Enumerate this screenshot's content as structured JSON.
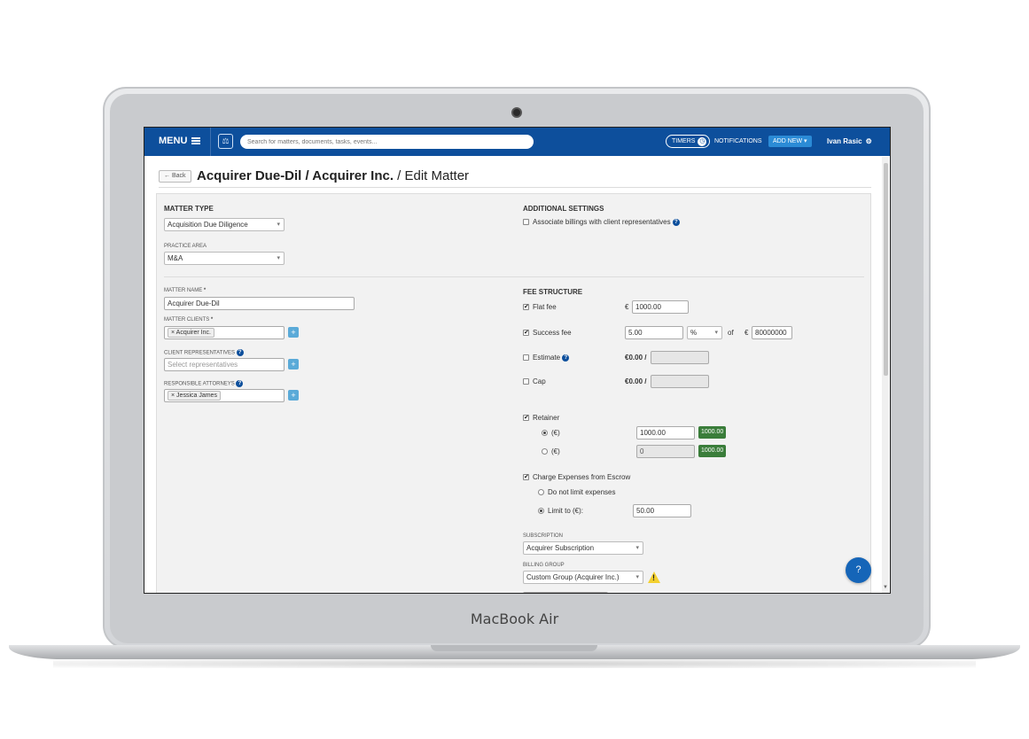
{
  "device": {
    "brand": "MacBook Air"
  },
  "topbar": {
    "menu_label": "MENU",
    "search_placeholder": "Search for matters, documents, tasks, events...",
    "timers_label": "TIMERS",
    "notifications_label": "NOTIFICATIONS",
    "add_new_label": "ADD NEW",
    "user_name": "Ivan Rasic"
  },
  "page": {
    "back_label": "← Back",
    "title_bold": "Acquirer Due-Dil / Acquirer Inc.",
    "title_rest": " / Edit Matter"
  },
  "left": {
    "matter_type_heading": "MATTER TYPE",
    "matter_type_value": "Acquisition Due Diligence",
    "practice_area_label": "PRACTICE AREA",
    "practice_area_value": "M&A",
    "matter_name_label": "MATTER NAME",
    "required_mark": "*",
    "matter_name_value": "Acquirer Due-Dil",
    "matter_clients_label": "MATTER CLIENTS",
    "matter_client_tag": "Acquirer Inc.",
    "client_reps_label": "CLIENT REPRESENTATIVES",
    "client_reps_placeholder": "Select representatives",
    "resp_attorneys_label": "RESPONSIBLE ATTORNEYS",
    "resp_attorney_tag": "Jessica James",
    "tag_remove": "×",
    "plus": "+"
  },
  "right": {
    "additional_heading": "ADDITIONAL SETTINGS",
    "associate_billings_label": "Associate billings with client representatives",
    "fee_heading": "FEE STRUCTURE",
    "currency": "€",
    "flat_fee_label": "Flat fee",
    "flat_fee_value": "1000.00",
    "success_fee_label": "Success fee",
    "success_fee_value": "5.00",
    "success_fee_unit": "%",
    "of_label": "of",
    "success_base_value": "80000000",
    "estimate_label": "Estimate",
    "estimate_amount": "€0.00 /",
    "cap_label": "Cap",
    "cap_amount": "€0.00 /",
    "retainer_label": "Retainer",
    "retainer_opt1_label": "(€)",
    "retainer_opt1_value": "1000.00",
    "retainer_opt1_badge": "1000.00",
    "retainer_opt2_label": "(€)",
    "retainer_opt2_value": "0",
    "retainer_opt2_badge": "1000.00",
    "charge_escrow_label": "Charge Expenses from Escrow",
    "no_limit_label": "Do not limit expenses",
    "limit_label": "Limit to (€):",
    "limit_value": "50.00",
    "subscription_label": "SUBSCRIPTION",
    "subscription_value": "Acquirer Subscription",
    "billing_group_label": "BILLING GROUP",
    "billing_group_value": "Custom Group (Acquirer Inc.)",
    "warning_mark": "!",
    "help_icon": "?",
    "check_mark": "✔"
  },
  "fab": {
    "label": "?"
  }
}
